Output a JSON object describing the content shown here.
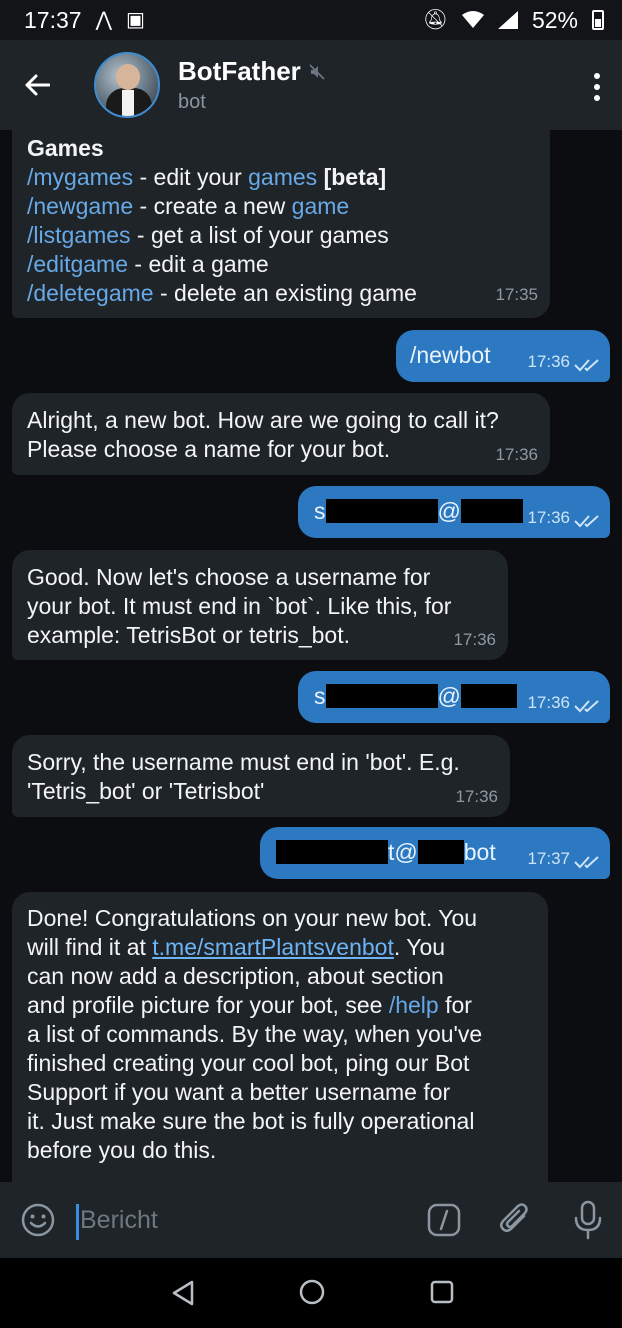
{
  "status_bar": {
    "time": "17:37",
    "battery": "52%"
  },
  "header": {
    "title": "BotFather",
    "subtitle": "bot"
  },
  "messages": {
    "games": {
      "heading": "Games",
      "lines": [
        {
          "cmd": "/mygames",
          "text": " - edit your ",
          "link": "games",
          "extra": " [beta]"
        },
        {
          "cmd": "/newgame",
          "text": " - create a new ",
          "link": "game"
        },
        {
          "cmd": "/listgames",
          "text": " - get a list of your games"
        },
        {
          "cmd": "/editgame",
          "text": " - edit a game"
        },
        {
          "cmd": "/deletegame",
          "text": " - delete an existing game"
        }
      ],
      "time": "17:35"
    },
    "newbot": {
      "text": "/newbot",
      "time": "17:36"
    },
    "alright": {
      "line1": "Alright, a new bot. How are we going to call it?",
      "line2": "Please choose a name for your bot.",
      "time": "17:36"
    },
    "name_reply": {
      "visible_char": "s",
      "at": "@",
      "time": "17:36"
    },
    "good": {
      "line1": "Good. Now let's choose a username for",
      "line2": "your bot. It must end in `bot`. Like this, for",
      "line3": "example: TetrisBot or tetris_bot.",
      "time": "17:36"
    },
    "username_reply1": {
      "visible_char": "s",
      "at": "@",
      "time": "17:36"
    },
    "sorry": {
      "line1": "Sorry, the username must end in 'bot'. E.g.",
      "line2": "'Tetris_bot' or 'Tetrisbot'",
      "time": "17:36"
    },
    "username_reply2": {
      "at": "t@",
      "suffix": "bot",
      "time": "17:37"
    },
    "done": {
      "p1": "Done! Congratulations on your new bot. You",
      "p2": "will find it at ",
      "link": "t.me/smartPlantsvenbot",
      "p3": ". You",
      "p4": "can now add a description, about section",
      "p5": "and profile picture for your bot, see ",
      "help": "/help",
      "p6": " for",
      "p7": "a list of commands. By the way, when you've",
      "p8": "finished creating your cool bot, ping our Bot",
      "p9": "Support if you want a better username for",
      "p10": "it. Just make sure the bot is fully operational",
      "p11": "before you do this."
    }
  },
  "input": {
    "placeholder": "Bericht"
  },
  "colors": {
    "accent": "#2c79c1",
    "link": "#67a9e7",
    "header_bg": "#1f2428",
    "bubble_in": "#1f2429"
  },
  "icons": [
    "back-arrow-icon",
    "mute-icon",
    "more-vert-icon",
    "emoji-icon",
    "slash-command-icon",
    "attach-icon",
    "mic-icon",
    "nav-back-icon",
    "nav-home-icon",
    "nav-recents-icon"
  ]
}
